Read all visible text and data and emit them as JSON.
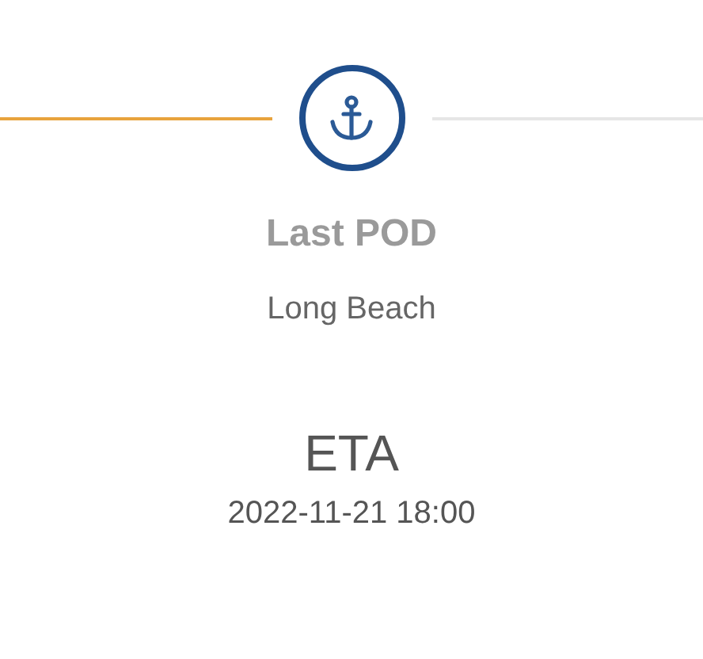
{
  "milestone": {
    "incoming_leg_done": true,
    "outgoing_leg_done": false,
    "title": "Last POD",
    "location": "Long Beach"
  },
  "eta": {
    "label": "ETA",
    "value": "2022-11-21 18:00"
  }
}
